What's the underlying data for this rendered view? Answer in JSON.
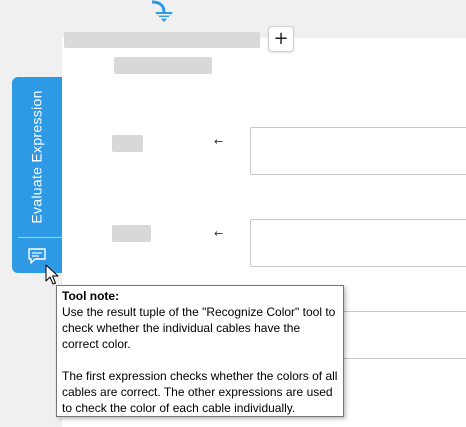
{
  "toolbar": {
    "add_label": "+"
  },
  "side_tab": {
    "label": "Evaluate Expression",
    "note_icon": "comment-icon",
    "color": "#2e9ae6"
  },
  "rows": [
    {
      "arrow": "←"
    },
    {
      "arrow": "←"
    }
  ],
  "tooltip": {
    "title": "Tool note:",
    "paragraph1": "Use the result tuple of the \"Recognize Color\" tool to check whether the individual cables have the correct color.",
    "paragraph2": "The first expression checks whether the colors of all cables are correct. The other expressions are used to check the color of each cable individually."
  }
}
